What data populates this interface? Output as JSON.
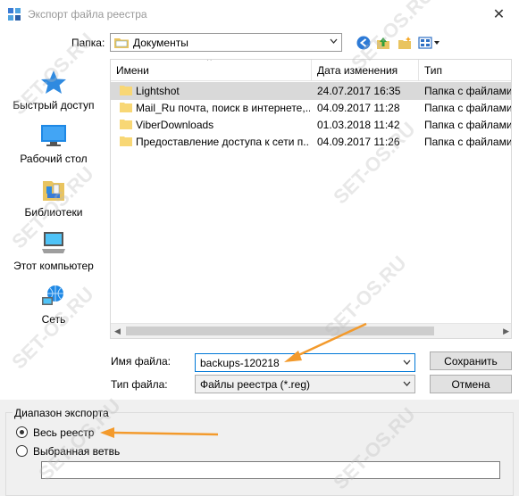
{
  "window": {
    "title": "Экспорт файла реестра",
    "close_glyph": "✕"
  },
  "folder": {
    "label": "Папка:",
    "value": "Документы"
  },
  "toolbar": {
    "icons": [
      "back-icon",
      "up-folder-icon",
      "new-folder-icon",
      "view-menu-icon"
    ]
  },
  "nav": [
    {
      "label": "Быстрый доступ",
      "icon": "star-icon"
    },
    {
      "label": "Рабочий стол",
      "icon": "desktop-icon"
    },
    {
      "label": "Библиотеки",
      "icon": "libraries-icon"
    },
    {
      "label": "Этот компьютер",
      "icon": "computer-icon"
    },
    {
      "label": "Сеть",
      "icon": "network-icon"
    }
  ],
  "list": {
    "headers": {
      "name": "Имени",
      "date": "Дата изменения",
      "type": "Тип"
    },
    "rows": [
      {
        "name": "Lightshot",
        "date": "24.07.2017 16:35",
        "type": "Папка с файлами",
        "selected": true
      },
      {
        "name": "Mail_Ru почта, поиск в интернете,...",
        "date": "04.09.2017 11:28",
        "type": "Папка с файлами",
        "selected": false
      },
      {
        "name": "ViberDownloads",
        "date": "01.03.2018 11:42",
        "type": "Папка с файлами",
        "selected": false
      },
      {
        "name": "Предоставление доступа к сети п...",
        "date": "04.09.2017 11:26",
        "type": "Папка с файлами",
        "selected": false
      }
    ]
  },
  "filename": {
    "label": "Имя файла:",
    "value": "backups-120218"
  },
  "filetype": {
    "label": "Тип файла:",
    "value": "Файлы реестра (*.reg)"
  },
  "buttons": {
    "save": "Сохранить",
    "cancel": "Отмена"
  },
  "export_range": {
    "title": "Диапазон экспорта",
    "options": [
      {
        "label": "Весь реестр",
        "checked": true
      },
      {
        "label": "Выбранная ветвь",
        "checked": false
      }
    ],
    "branch_value": ""
  },
  "watermark": "SET-OS.RU",
  "colors": {
    "annotation_arrow": "#f39a2c",
    "accent": "#0078d7",
    "folder": "#f8d775"
  }
}
